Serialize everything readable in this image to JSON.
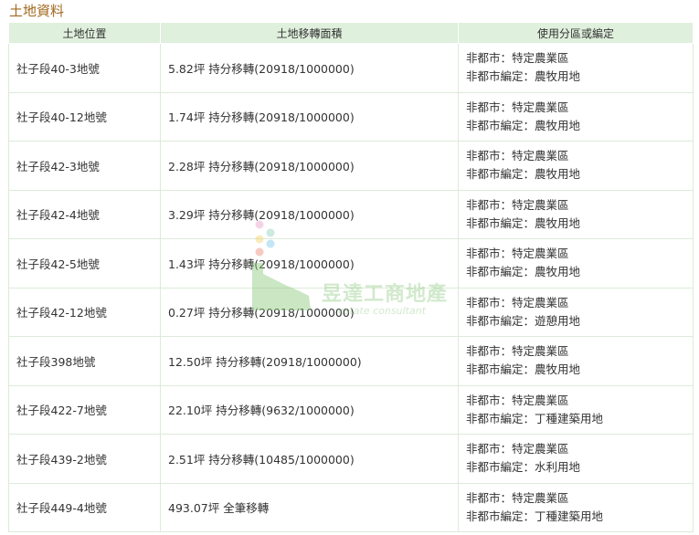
{
  "section_title": "土地資料",
  "headers": {
    "location": "土地位置",
    "area": "土地移轉面積",
    "zoning": "使用分區或編定"
  },
  "rows": [
    {
      "location": "社子段40-3地號",
      "area": "5.82坪 持分移轉(20918/1000000)",
      "zone1": "非都市：特定農業區",
      "zone2": "非都市編定：農牧用地"
    },
    {
      "location": "社子段40-12地號",
      "area": "1.74坪 持分移轉(20918/1000000)",
      "zone1": "非都市：特定農業區",
      "zone2": "非都市編定：農牧用地"
    },
    {
      "location": "社子段42-3地號",
      "area": "2.28坪 持分移轉(20918/1000000)",
      "zone1": "非都市：特定農業區",
      "zone2": "非都市編定：農牧用地"
    },
    {
      "location": "社子段42-4地號",
      "area": "3.29坪 持分移轉(20918/1000000)",
      "zone1": "非都市：特定農業區",
      "zone2": "非都市編定：農牧用地"
    },
    {
      "location": "社子段42-5地號",
      "area": "1.43坪 持分移轉(20918/1000000)",
      "zone1": "非都市：特定農業區",
      "zone2": "非都市編定：農牧用地"
    },
    {
      "location": "社子段42-12地號",
      "area": "0.27坪 持分移轉(20918/1000000)",
      "zone1": "非都市：特定農業區",
      "zone2": "非都市編定：遊憩用地"
    },
    {
      "location": "社子段398地號",
      "area": "12.50坪 持分移轉(20918/1000000)",
      "zone1": "非都市：特定農業區",
      "zone2": "非都市編定：農牧用地"
    },
    {
      "location": "社子段422-7地號",
      "area": "22.10坪 持分移轉(9632/1000000)",
      "zone1": "非都市：特定農業區",
      "zone2": "非都市編定：丁種建築用地"
    },
    {
      "location": "社子段439-2地號",
      "area": "2.51坪 持分移轉(10485/1000000)",
      "zone1": "非都市：特定農業區",
      "zone2": "非都市編定：水利用地"
    },
    {
      "location": "社子段449-4地號",
      "area": "493.07坪 全筆移轉",
      "zone1": "非都市：特定農業區",
      "zone2": "非都市編定：丁種建築用地"
    }
  ],
  "watermark": {
    "brand": "昱達工商地產",
    "sub": "estate consultant"
  },
  "colors": {
    "title": "#a0681d",
    "header_bg": "#dff0dc",
    "border": "#dcebd8"
  }
}
